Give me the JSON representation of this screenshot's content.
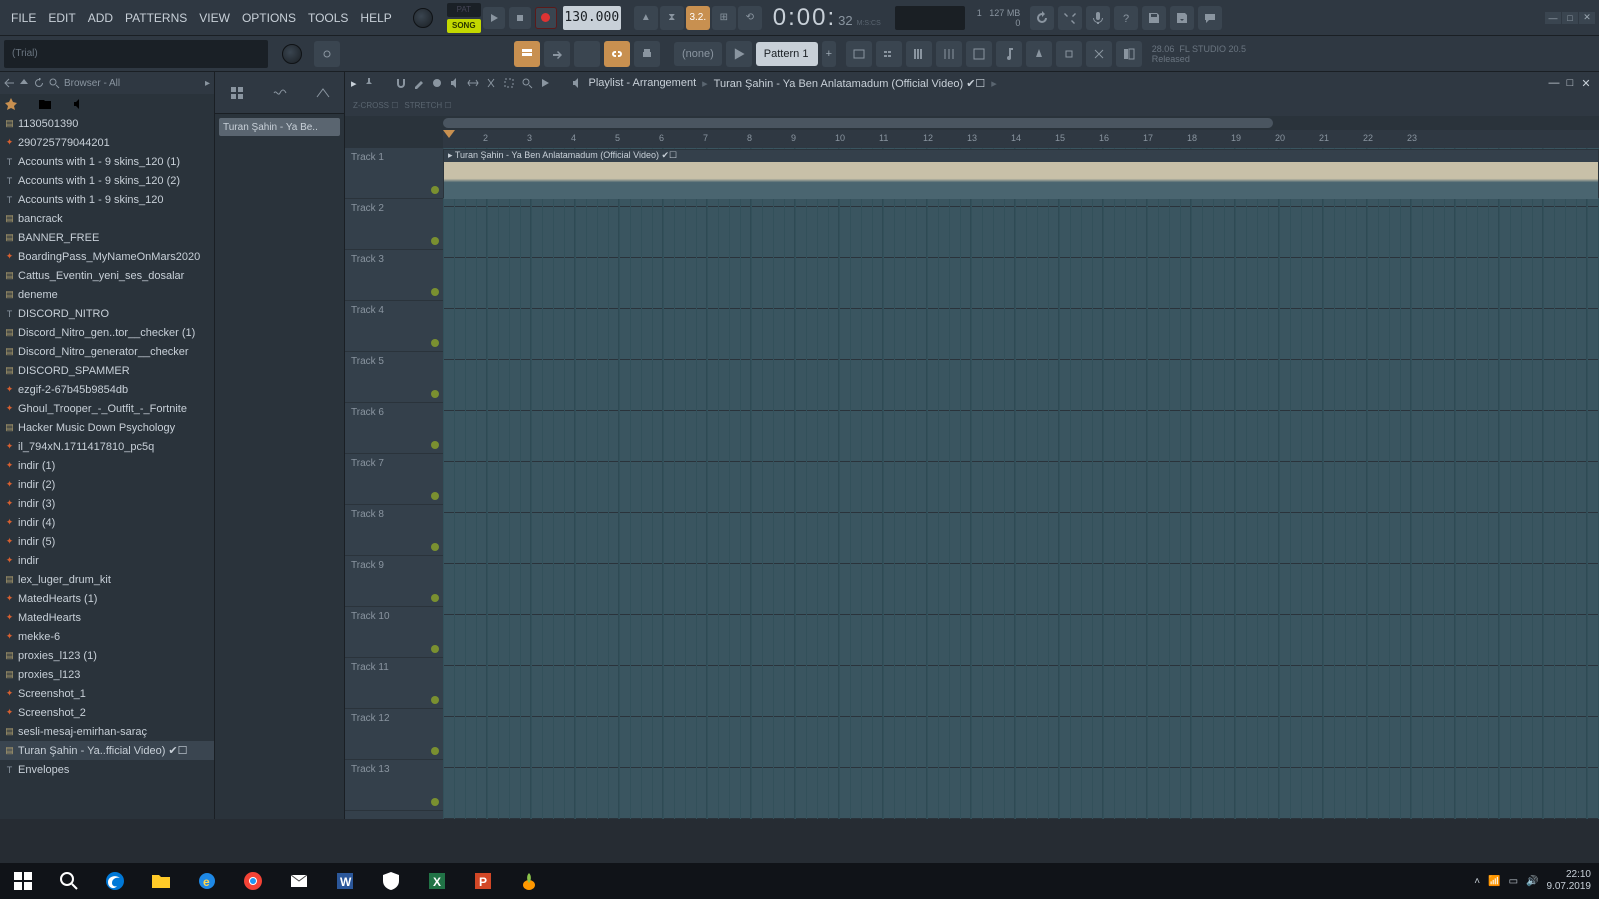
{
  "menu": [
    "FILE",
    "EDIT",
    "ADD",
    "PATTERNS",
    "VIEW",
    "OPTIONS",
    "TOOLS",
    "HELP"
  ],
  "mode": {
    "pat": "PAT",
    "song": "SONG"
  },
  "tempo": "130.000",
  "snap": "3.2.",
  "timecode": {
    "main": "0:00:",
    "sub": "32",
    "label": "M:S:CS"
  },
  "mem": {
    "val": "127 MB",
    "cnt": "0",
    "one": "1"
  },
  "hint": "(Trial)",
  "combo_none": "(none)",
  "pattern": "Pattern 1",
  "version": {
    "num": "28.06",
    "name": "FL STUDIO 20.5",
    "state": "Released"
  },
  "browser": {
    "title": "Browser - All"
  },
  "browser_items": [
    {
      "t": "1130501390",
      "i": "zip"
    },
    {
      "t": "290725779044201",
      "i": "fire"
    },
    {
      "t": "Accounts with 1 - 9 skins_120 (1)",
      "i": "txt"
    },
    {
      "t": "Accounts with 1 - 9 skins_120 (2)",
      "i": "txt"
    },
    {
      "t": "Accounts with 1 - 9 skins_120",
      "i": "txt"
    },
    {
      "t": "bancrack",
      "i": "zip"
    },
    {
      "t": "BANNER_FREE",
      "i": "zip"
    },
    {
      "t": "BoardingPass_MyNameOnMars2020",
      "i": "fire"
    },
    {
      "t": "Cattus_Eventin_yeni_ses_dosalar",
      "i": "zip"
    },
    {
      "t": "deneme",
      "i": "zip"
    },
    {
      "t": "DISCORD_NITRO",
      "i": "txt"
    },
    {
      "t": "Discord_Nitro_gen..tor__checker (1)",
      "i": "zip"
    },
    {
      "t": "Discord_Nitro_generator__checker",
      "i": "zip"
    },
    {
      "t": "DISCORD_SPAMMER",
      "i": "zip"
    },
    {
      "t": "ezgif-2-67b45b9854db",
      "i": "fire"
    },
    {
      "t": "Ghoul_Trooper_-_Outfit_-_Fortnite",
      "i": "fire"
    },
    {
      "t": "Hacker Music Down Psychology",
      "i": "zip"
    },
    {
      "t": "il_794xN.1711417810_pc5q",
      "i": "fire"
    },
    {
      "t": "indir (1)",
      "i": "fire"
    },
    {
      "t": "indir (2)",
      "i": "fire"
    },
    {
      "t": "indir (3)",
      "i": "fire"
    },
    {
      "t": "indir (4)",
      "i": "fire"
    },
    {
      "t": "indir (5)",
      "i": "fire"
    },
    {
      "t": "indir",
      "i": "fire"
    },
    {
      "t": "lex_luger_drum_kit",
      "i": "zip"
    },
    {
      "t": "MatedHearts (1)",
      "i": "fire"
    },
    {
      "t": "MatedHearts",
      "i": "fire"
    },
    {
      "t": "mekke-6",
      "i": "fire"
    },
    {
      "t": "proxies_l123 (1)",
      "i": "zip"
    },
    {
      "t": "proxies_l123",
      "i": "zip"
    },
    {
      "t": "Screenshot_1",
      "i": "fire"
    },
    {
      "t": "Screenshot_2",
      "i": "fire"
    },
    {
      "t": "sesli-mesaj-emirhan-saraç",
      "i": "zip"
    },
    {
      "t": "Turan Şahin - Ya..fficial Video) ✔☐",
      "i": "zip",
      "sel": true
    },
    {
      "t": "Envelopes",
      "i": "txt"
    }
  ],
  "picker_clip": "Turan Şahin - Ya Be..",
  "playlist": {
    "crumb1": "Playlist - Arrangement",
    "crumb2": "Turan Şahin - Ya Ben Anlatamadum (Official Video) ✔☐"
  },
  "zcross": "Z-CROSS ☐",
  "stretch": "STRETCH ☐",
  "tracks": [
    "Track 1",
    "Track 2",
    "Track 3",
    "Track 4",
    "Track 5",
    "Track 6",
    "Track 7",
    "Track 8",
    "Track 9",
    "Track 10",
    "Track 11",
    "Track 12",
    "Track 13"
  ],
  "clip_name": "▸ Turan Şahin - Ya Ben Anlatamadum (Official Video) ✔☐",
  "ruler": [
    2,
    3,
    4,
    5,
    6,
    7,
    8,
    9,
    10,
    11,
    12,
    13,
    14,
    15,
    16,
    17,
    18,
    19,
    20,
    21,
    22,
    23
  ],
  "systray": {
    "time": "22:10",
    "date": "9.07.2019"
  }
}
